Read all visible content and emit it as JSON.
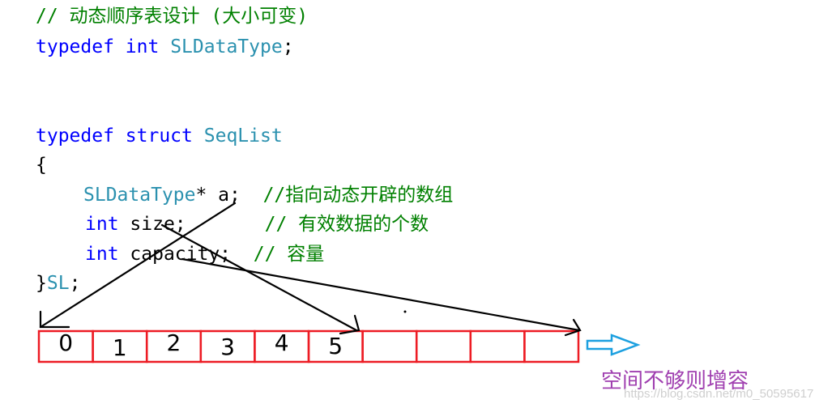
{
  "code": {
    "line1_comment": "// 动态顺序表设计 (大小可变)",
    "line2": {
      "kw": "typedef",
      "kw2": "int",
      "type": "SLDataType",
      "end": ";"
    },
    "line3": {
      "kw": "typedef",
      "kw2": "struct",
      "type": "SeqList"
    },
    "open_brace": "{",
    "member_a": {
      "type": "SLDataType",
      "rest": "* a;",
      "comment": "//指向动态开辟的数组"
    },
    "member_size": {
      "kw": "int",
      "name": "size;",
      "comment": "// 有效数据的个数"
    },
    "member_capacity": {
      "kw": "int",
      "name": "capacity;",
      "comment": "// 容量"
    },
    "close": {
      "brace": "}",
      "type": "SL",
      "end": ";"
    }
  },
  "array": {
    "cells": [
      "0",
      "1",
      "2",
      "3",
      "4",
      "5",
      "",
      "",
      "",
      ""
    ],
    "border_color": "#ed1c24"
  },
  "annotation": {
    "text": "空间不够则增容",
    "text_color": "#a040b0",
    "arrow_color": "#1ca0e0"
  },
  "watermark": "https://blog.csdn.net/m0_50595617"
}
